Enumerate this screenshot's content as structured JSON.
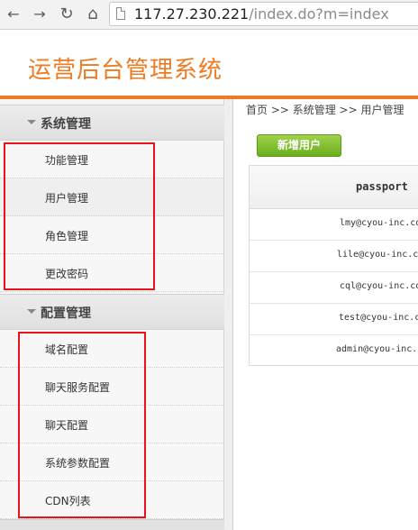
{
  "browser": {
    "url_host": "117.27.230.221",
    "url_path": "/index.do?m=index",
    "back_glyph": "←",
    "forward_glyph": "→",
    "reload_glyph": "↻",
    "home_glyph": "⌂"
  },
  "header": {
    "title": "运营后台管理系统",
    "accent_color": "#ee7b22"
  },
  "sidebar": {
    "groups": [
      {
        "label": "系统管理",
        "items": [
          {
            "label": "功能管理"
          },
          {
            "label": "用户管理"
          },
          {
            "label": "角色管理"
          },
          {
            "label": "更改密码"
          }
        ]
      },
      {
        "label": "配置管理",
        "items": [
          {
            "label": "域名配置"
          },
          {
            "label": "聊天服务配置"
          },
          {
            "label": "聊天配置"
          },
          {
            "label": "系统参数配置"
          },
          {
            "label": "CDN列表"
          }
        ]
      }
    ]
  },
  "main": {
    "breadcrumb": "首页 >> 系统管理 >> 用户管理",
    "add_user_label": "新增用户",
    "table": {
      "columns": [
        "passport"
      ],
      "rows": [
        {
          "passport": "lmy@cyou-inc.co"
        },
        {
          "passport": "lile@cyou-inc.co"
        },
        {
          "passport": "cql@cyou-inc.co"
        },
        {
          "passport": "test@cyou-inc.co"
        },
        {
          "passport": "admin@cyou-inc.co"
        }
      ]
    }
  },
  "annotation_color": "#e8141c"
}
